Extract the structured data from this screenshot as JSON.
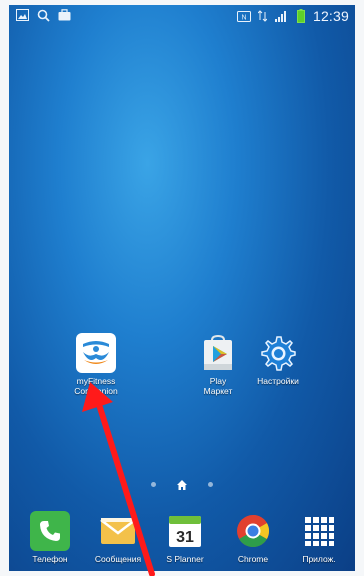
{
  "status_bar": {
    "left_icons": [
      "gallery-icon",
      "search-icon",
      "briefcase-icon"
    ],
    "right_icons": [
      "nfc-icon",
      "data-arrows-icon",
      "signal-icon",
      "battery-icon"
    ],
    "time": "12:39"
  },
  "home_apps": [
    {
      "name": "myfitness-companion",
      "label": "myFitness\nCompanion",
      "icon": "myfitness-icon"
    },
    {
      "name": "play-market",
      "label": "Play\nМаркет",
      "icon": "play-store-icon"
    },
    {
      "name": "settings",
      "label": "Настройки",
      "icon": "gear-icon"
    }
  ],
  "page_indicator": {
    "pages": 3,
    "current": "home"
  },
  "dock": [
    {
      "name": "phone",
      "label": "Телефон",
      "icon": "phone-icon"
    },
    {
      "name": "messages",
      "label": "Сообщения",
      "icon": "messages-icon"
    },
    {
      "name": "s-planner",
      "label": "S Planner",
      "icon": "calendar-icon",
      "calendar_day": "31"
    },
    {
      "name": "chrome",
      "label": "Chrome",
      "icon": "chrome-icon"
    },
    {
      "name": "apps",
      "label": "Прилож.",
      "icon": "apps-grid-icon"
    }
  ],
  "colors": {
    "annotation_arrow": "#ff1a1a",
    "wallpaper_light": "#3aa4e6",
    "wallpaper_dark": "#0b3f86"
  }
}
